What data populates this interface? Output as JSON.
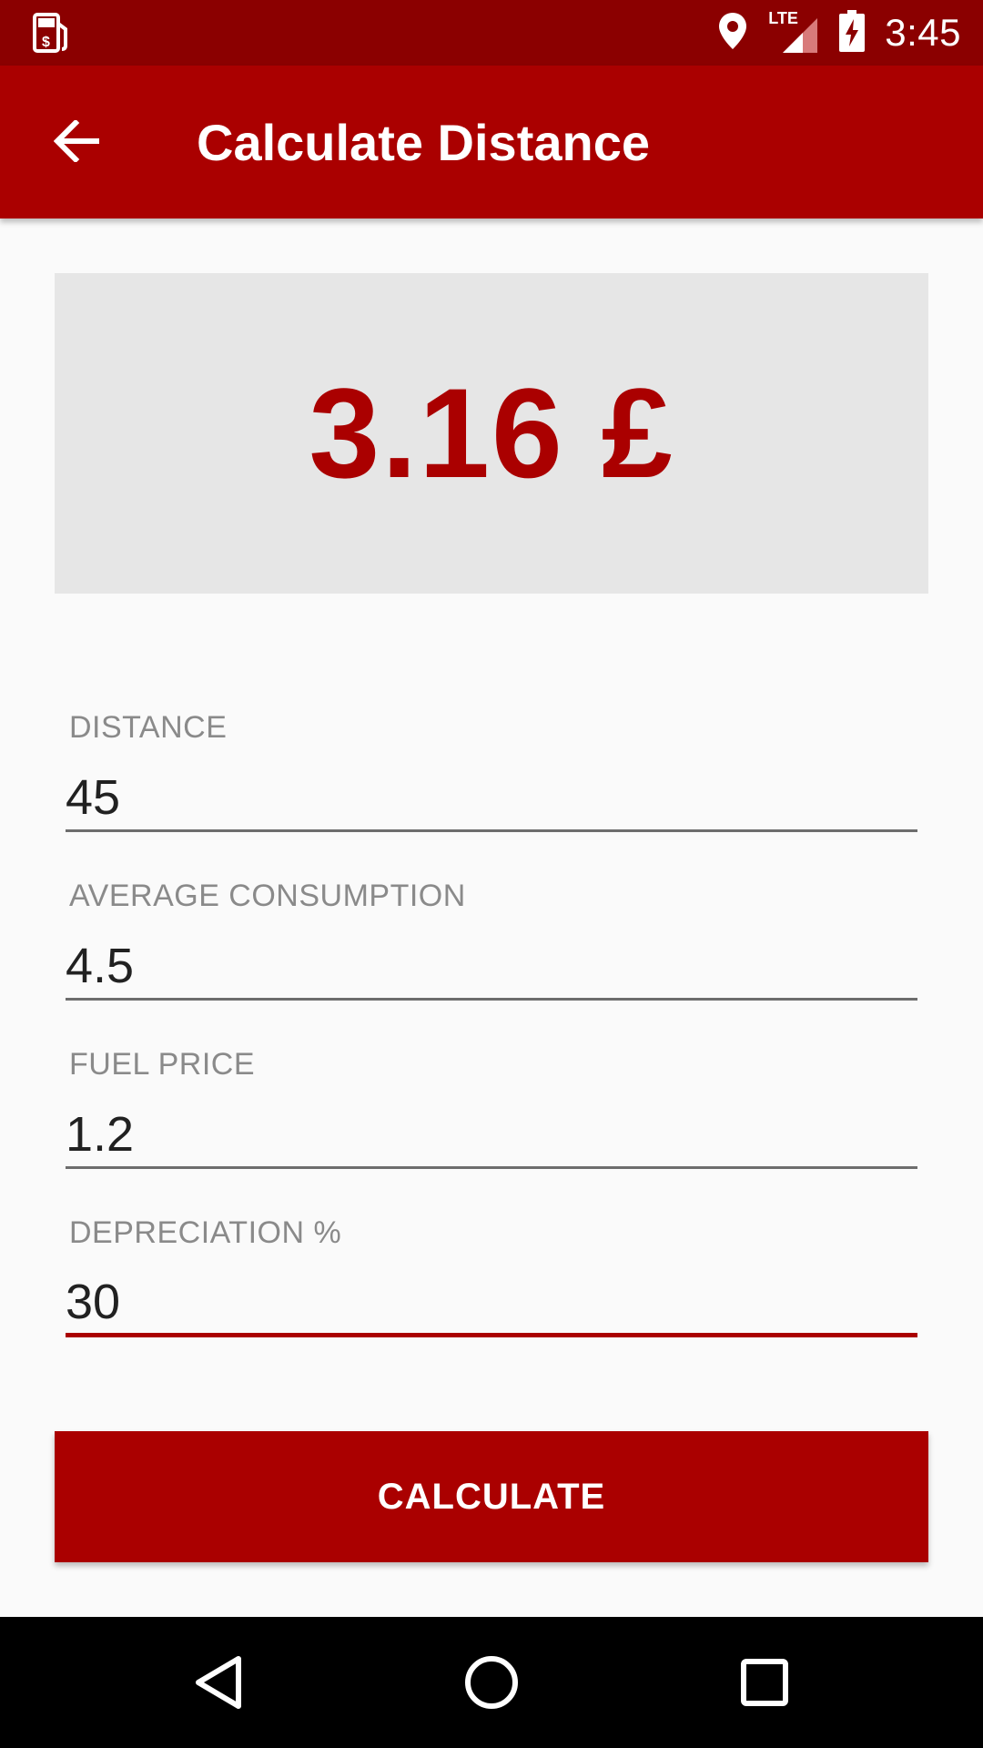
{
  "status_bar": {
    "left_icon": "fuel-pump-dollar-icon",
    "icons": [
      "location-pin-icon",
      "lte-signal-icon",
      "battery-charging-icon"
    ],
    "lte_label": "LTE",
    "time": "3:45",
    "background": "#8b0000"
  },
  "app_bar": {
    "back_icon": "arrow-back-icon",
    "title": "Calculate Distance",
    "background": "#aa0000"
  },
  "result": {
    "value": "3.16 £",
    "color": "#aa0000"
  },
  "form": {
    "fields": [
      {
        "label": "DISTANCE",
        "value": "45"
      },
      {
        "label": "AVERAGE CONSUMPTION",
        "value": "4.5"
      },
      {
        "label": "FUEL PRICE",
        "value": "1.2"
      },
      {
        "label": "DEPRECIATION %",
        "value": "30",
        "focused": true
      }
    ]
  },
  "calculate_button": {
    "label": "CALCULATE"
  },
  "nav_bar": {
    "buttons": [
      "back-triangle-icon",
      "home-circle-icon",
      "recents-square-icon"
    ]
  }
}
